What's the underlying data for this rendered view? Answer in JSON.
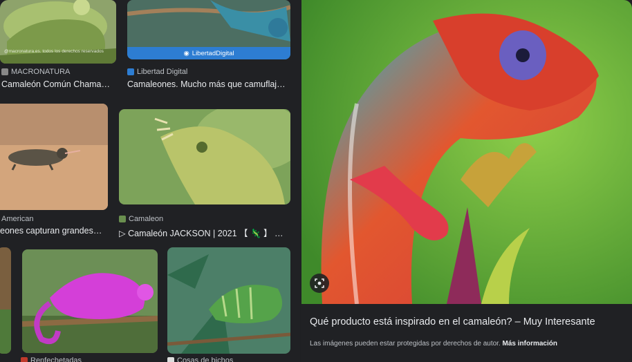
{
  "results": [
    {
      "source": "MACRONATURA",
      "caption": "Camaleón Común Chamaeleo...",
      "watermark": "@macronatura.es. todos los derechos reservados"
    },
    {
      "source": "Libertad Digital",
      "caption": "Camaleones. Mucho más que camuflaje - M...",
      "badge": "LibertadDigital"
    },
    {
      "source": "American",
      "caption": "eones capturan grandes pre..."
    },
    {
      "source": "Camaleon",
      "caption": "▷ Camaleón JACKSON | 2021 【 🦎 】 » Guía..."
    },
    {
      "source": "Renfechetadas",
      "caption": ""
    },
    {
      "source": "Cosas de bichos",
      "caption": ""
    }
  ],
  "preview": {
    "title": "Qué producto está inspirado en el camaleón? – Muy Interesante",
    "note": "Las imágenes pueden estar protegidas por derechos de autor.",
    "note_link": "Más información",
    "lens_icon": "lens-icon"
  },
  "colors": {
    "background": "#202124",
    "text": "#e8eaed",
    "muted": "#bdc1c6",
    "libertad_blue": "#2d7dd2"
  }
}
